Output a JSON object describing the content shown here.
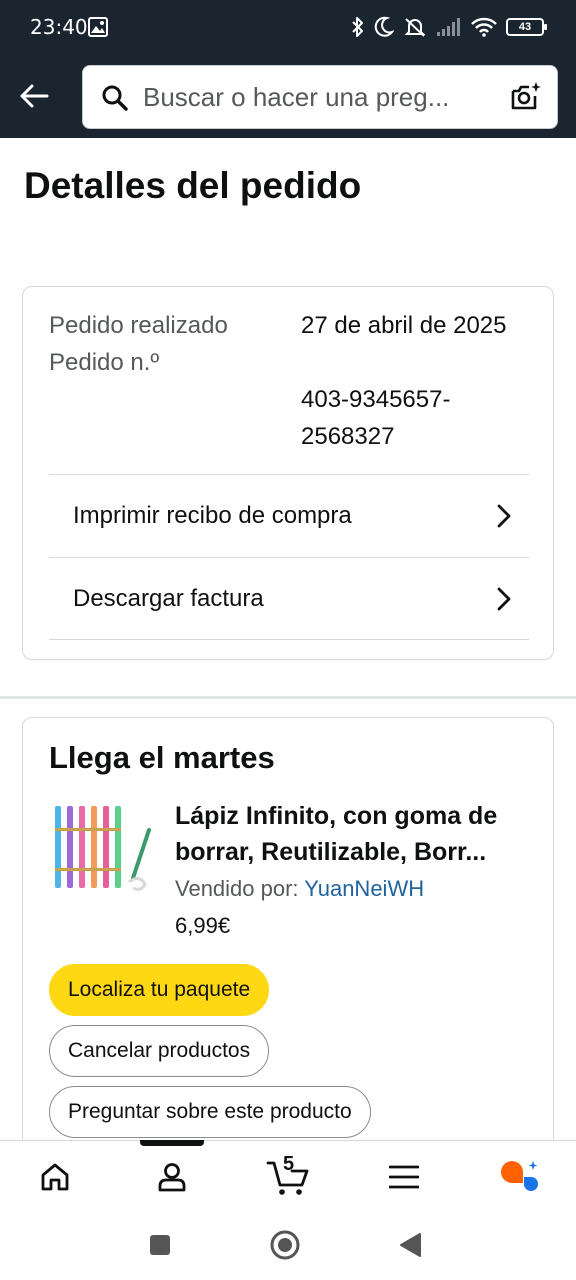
{
  "status_bar": {
    "time": "23:40",
    "battery": "43"
  },
  "search": {
    "placeholder": "Buscar o hacer una preg..."
  },
  "page": {
    "title": "Detalles del pedido"
  },
  "order": {
    "placed_label": "Pedido realizado",
    "number_label": "Pedido n.º",
    "date": "27 de abril de 2025",
    "number": "403-9345657-2568327",
    "links": [
      {
        "label": "Imprimir recibo de compra"
      },
      {
        "label": "Descargar factura"
      }
    ]
  },
  "delivery": {
    "title": "Llega el martes",
    "product": {
      "name": "Lápiz Infinito, con goma de borrar, Reutilizable, Borr...",
      "seller_label": "Vendido por:",
      "seller": "YuanNeiWH",
      "price": "6,99€"
    },
    "buttons": {
      "track": "Localiza tu paquete",
      "cancel": "Cancelar productos",
      "ask": "Preguntar sobre este producto"
    }
  },
  "bottom_nav": {
    "cart_count": "5",
    "active": "profile"
  },
  "colors": {
    "header_bg": "#1b2530",
    "primary_button": "#ffd814",
    "link": "#2162a1",
    "rufus_orange": "#ff6200",
    "rufus_blue": "#1a73e8"
  },
  "icons": [
    "photo-icon",
    "bluetooth-icon",
    "moon-icon",
    "silent-icon",
    "signal-icon",
    "wifi-icon",
    "battery-icon",
    "back-arrow-icon",
    "search-icon",
    "camera-search-icon",
    "chevron-right-icon",
    "home-icon",
    "profile-icon",
    "cart-icon",
    "menu-icon",
    "rufus-icon"
  ]
}
